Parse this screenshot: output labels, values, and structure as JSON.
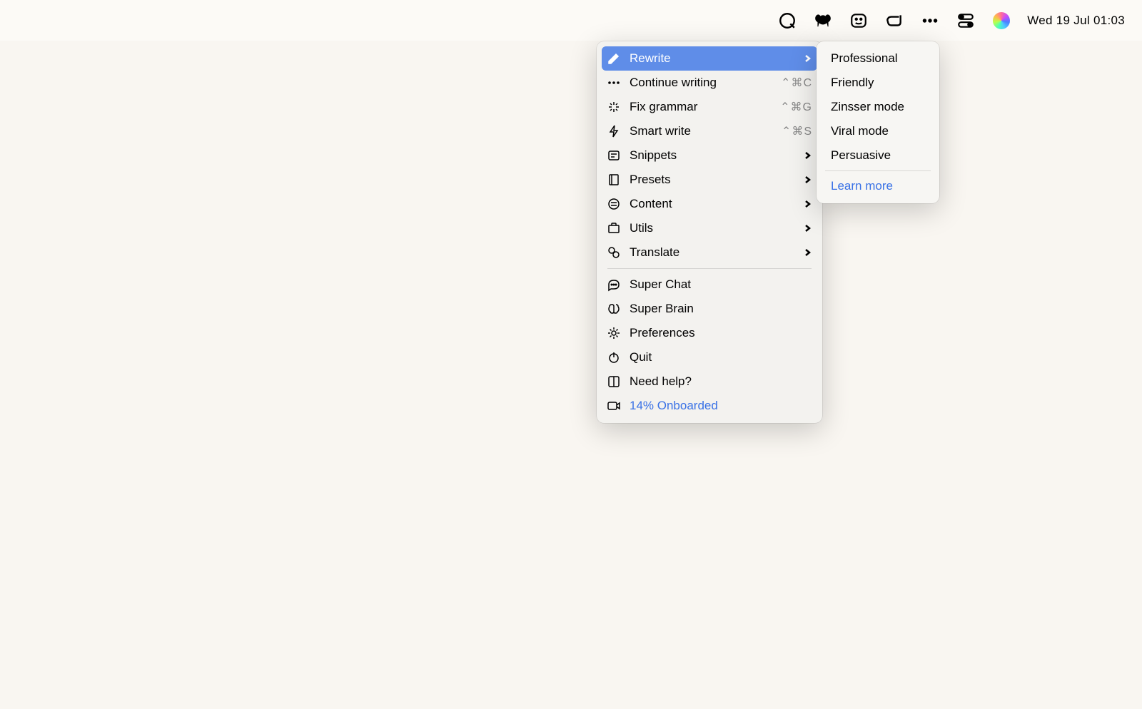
{
  "menubar": {
    "datetime": "Wed 19 Jul  01:03"
  },
  "menu": {
    "items": [
      {
        "label": "Rewrite",
        "icon": "pencil",
        "hasSubmenu": true,
        "highlighted": true
      },
      {
        "label": "Continue writing",
        "icon": "dots",
        "shortcut": "⌃⌘C"
      },
      {
        "label": "Fix grammar",
        "icon": "sparkle",
        "shortcut": "⌃⌘G"
      },
      {
        "label": "Smart write",
        "icon": "bolt",
        "shortcut": "⌃⌘S"
      },
      {
        "label": "Snippets",
        "icon": "snippet",
        "hasSubmenu": true
      },
      {
        "label": "Presets",
        "icon": "book",
        "hasSubmenu": true
      },
      {
        "label": "Content",
        "icon": "content",
        "hasSubmenu": true
      },
      {
        "label": "Utils",
        "icon": "briefcase",
        "hasSubmenu": true
      },
      {
        "label": "Translate",
        "icon": "translate",
        "hasSubmenu": true
      }
    ],
    "items2": [
      {
        "label": "Super Chat",
        "icon": "chat"
      },
      {
        "label": "Super Brain",
        "icon": "brain"
      },
      {
        "label": "Preferences",
        "icon": "gear"
      },
      {
        "label": "Quit",
        "icon": "power"
      },
      {
        "label": "Need help?",
        "icon": "help"
      },
      {
        "label": "14% Onboarded",
        "icon": "video",
        "link": true
      }
    ]
  },
  "submenu": {
    "items": [
      {
        "label": "Professional"
      },
      {
        "label": "Friendly"
      },
      {
        "label": "Zinsser mode"
      },
      {
        "label": "Viral mode"
      },
      {
        "label": "Persuasive"
      }
    ],
    "learnMore": "Learn more"
  }
}
